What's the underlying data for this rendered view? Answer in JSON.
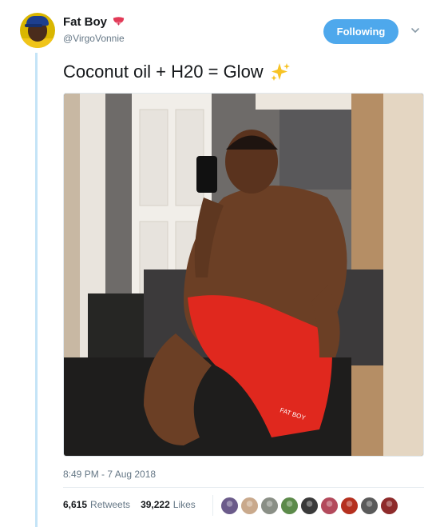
{
  "tweet": {
    "author": {
      "display_name": "Fat Boy",
      "handle": "@VirgoVonnie",
      "name_emoji": "tongue-face-icon"
    },
    "follow_button_label": "Following",
    "text": "Coconut oil + H20 = Glow",
    "text_emoji": "sparkles-icon",
    "timestamp": "8:49 PM - 7 Aug 2018",
    "stats": {
      "retweets_count": "6,615",
      "retweets_label": "Retweets",
      "likes_count": "39,222",
      "likes_label": "Likes"
    },
    "likers": [
      {
        "name": "liker-avatar-1",
        "color": "#6b5b8a"
      },
      {
        "name": "liker-avatar-2",
        "color": "#c9a98c"
      },
      {
        "name": "liker-avatar-3",
        "color": "#8a8f86"
      },
      {
        "name": "liker-avatar-4",
        "color": "#5c8a4a"
      },
      {
        "name": "liker-avatar-5",
        "color": "#3a3a3a"
      },
      {
        "name": "liker-avatar-6",
        "color": "#b34a5c"
      },
      {
        "name": "liker-avatar-7",
        "color": "#b5301f"
      },
      {
        "name": "liker-avatar-8",
        "color": "#5a5a5a"
      },
      {
        "name": "liker-avatar-9",
        "color": "#8e2b2b"
      }
    ]
  },
  "colors": {
    "accent": "#4ea8ec",
    "thread_line": "#c4e4f7",
    "muted_text": "#657786",
    "shorts": "#e0281e"
  }
}
